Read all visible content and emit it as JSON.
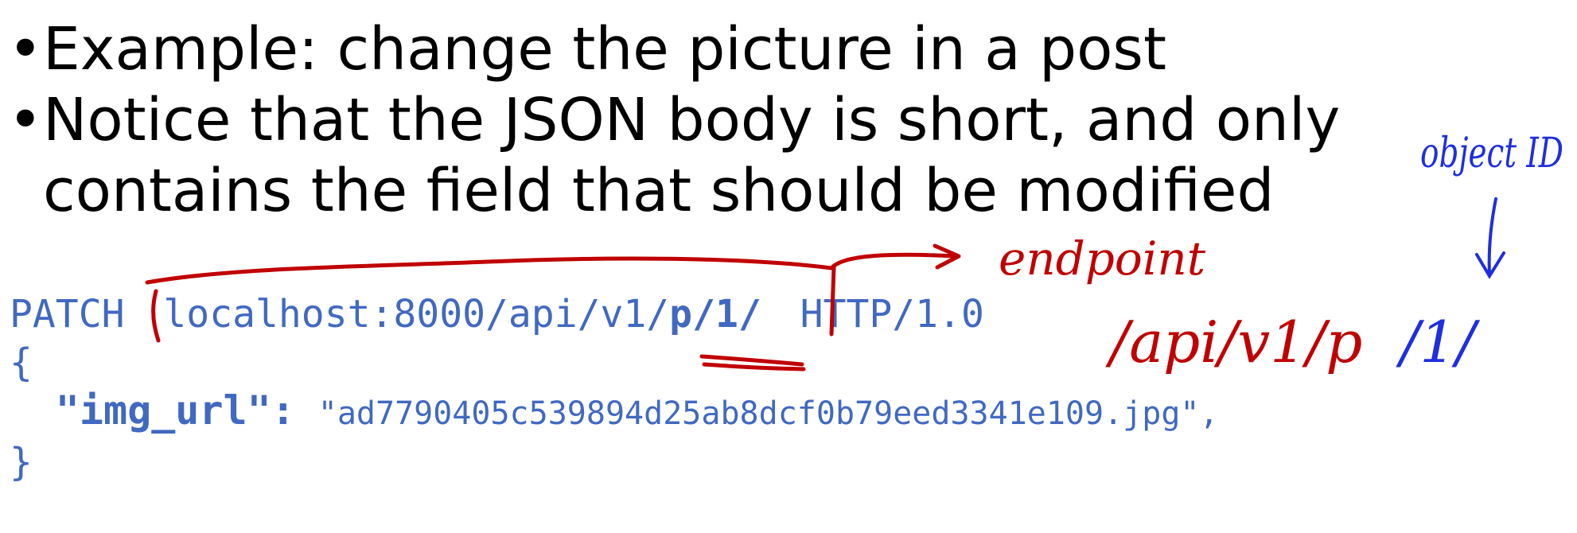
{
  "slide": {
    "bullets": [
      {
        "text": "Example: change the picture in a post"
      },
      {
        "text": "Notice that the JSON body is short, and only contains the field that should be modified"
      }
    ],
    "bullet_glyph": "•",
    "code": {
      "method": "PATCH",
      "url_base": "localhost:8000/api/v1/",
      "url_path": "p/1/",
      "protocol": "HTTP/1.0",
      "open_brace": "{",
      "key": "\"img_url\":",
      "value": "\"ad7790405c539894d25ab8dcf0b79eed3341e109.jpg\",",
      "close_brace": "}"
    },
    "annotations": {
      "endpoint_label": "endpoint",
      "endpoint_path": "/api/v1/p",
      "object_id_label": "object ID",
      "object_id_value": "/1/"
    },
    "colors": {
      "text": "#000000",
      "code": "#4169c1",
      "ink_red": "#c00000",
      "ink_blue": "#1f2ee0"
    }
  }
}
